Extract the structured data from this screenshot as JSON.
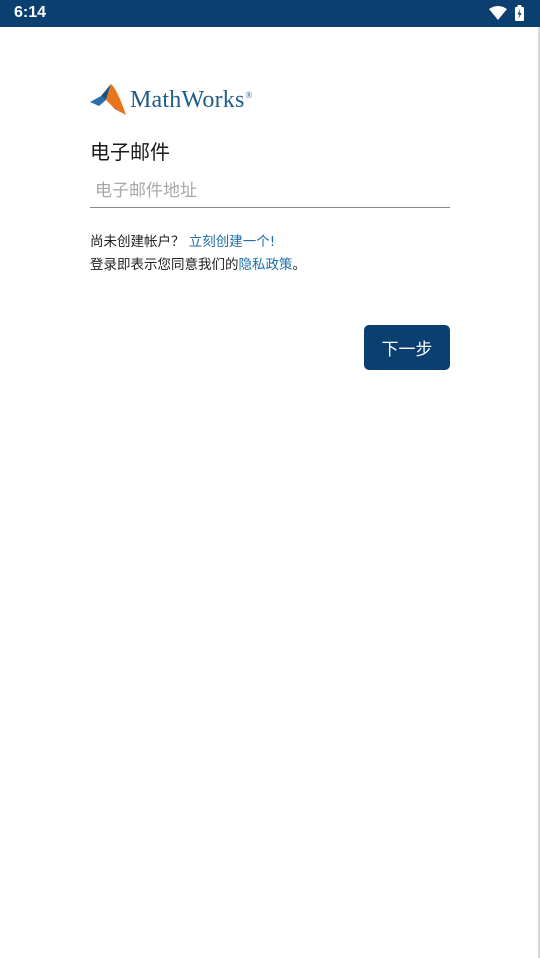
{
  "status_bar": {
    "time": "6:14",
    "icons": [
      "wifi-icon",
      "battery-icon"
    ]
  },
  "logo": {
    "text": "MathWorks",
    "registered_mark": "®",
    "icon": "matlab-membrane-logo"
  },
  "form": {
    "email_label": "电子邮件",
    "email_placeholder": "电子邮件地址",
    "email_value": ""
  },
  "signup": {
    "prompt": "尚未创建帐户？",
    "link": "立刻创建一个!"
  },
  "privacy": {
    "prefix": "登录即表示您同意我们的",
    "link": "隐私政策",
    "suffix": "。"
  },
  "actions": {
    "next_label": "下一步"
  },
  "colors": {
    "brand_blue": "#0a3f70",
    "link_blue": "#1d6fa8",
    "logo_orange": "#e8751a"
  }
}
